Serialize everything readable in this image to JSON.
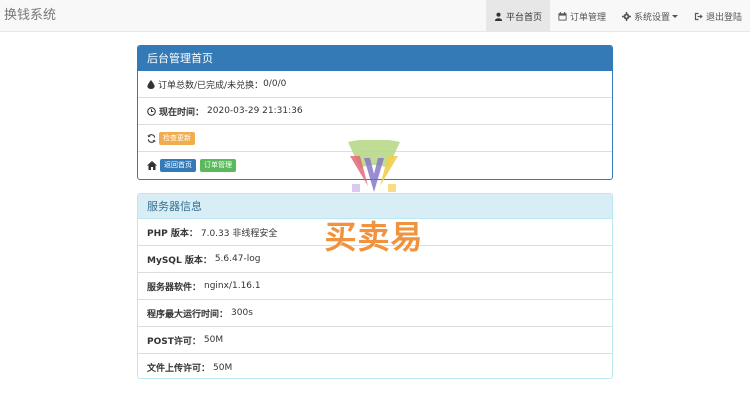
{
  "navbar": {
    "brand": "换钱系统",
    "items": [
      {
        "label": "平台首页",
        "icon": "user-icon"
      },
      {
        "label": "订单管理",
        "icon": "calendar-icon"
      },
      {
        "label": "系统设置",
        "icon": "gear-icon"
      },
      {
        "label": "退出登陆",
        "icon": "logout-icon"
      }
    ]
  },
  "admin_panel": {
    "title": "后台管理首页",
    "orders_label": "订单总数/已完成/未兑换：",
    "orders_value": "0/0/0",
    "time_label": "现在时间：",
    "time_value": "2020-03-29 21:31:36",
    "check_update_button": "检查更新",
    "home_button": "返回首页",
    "orders_button": "订单管理"
  },
  "server_panel": {
    "title": "服务器信息",
    "rows": [
      {
        "label": "PHP 版本：",
        "value": "7.0.33 非线程安全"
      },
      {
        "label": "MySQL 版本：",
        "value": "5.6.47-log"
      },
      {
        "label": "服务器软件：",
        "value": "nginx/1.16.1"
      },
      {
        "label": "程序最大运行时间：",
        "value": "300s"
      },
      {
        "label": "POST许可：",
        "value": "50M"
      },
      {
        "label": "文件上传许可：",
        "value": "50M"
      }
    ]
  },
  "watermark": {
    "text": "买卖易"
  },
  "colors": {
    "primary": "#337ab7",
    "info_bg": "#d9edf7",
    "warning": "#f0ad4e",
    "success": "#5cb85c"
  }
}
